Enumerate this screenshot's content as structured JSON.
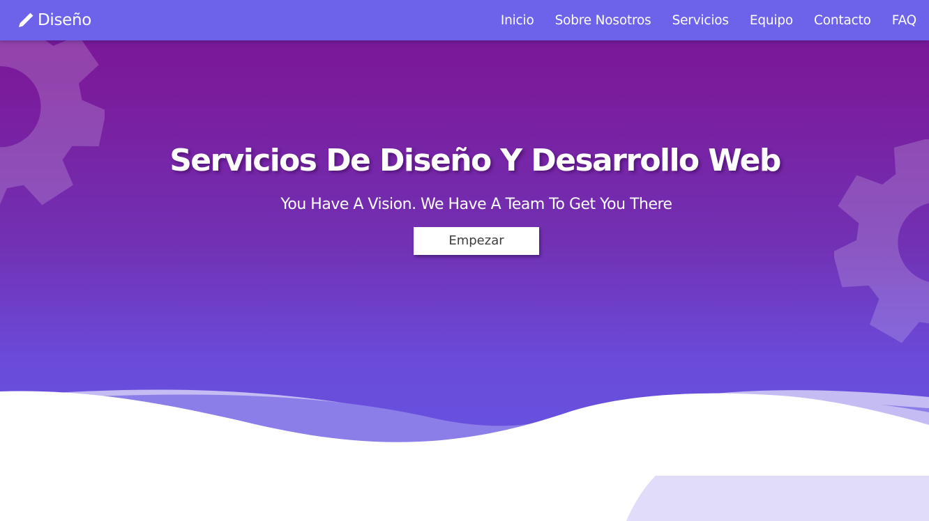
{
  "navbar": {
    "brand": {
      "icon": "pencil-icon",
      "name": "Diseño"
    },
    "links": [
      {
        "label": "Inicio"
      },
      {
        "label": "Sobre Nosotros"
      },
      {
        "label": "Servicios"
      },
      {
        "label": "Equipo"
      },
      {
        "label": "Contacto"
      },
      {
        "label": "FAQ"
      }
    ]
  },
  "hero": {
    "title": "Servicios De Diseño Y Desarrollo Web",
    "subtitle": "You Have A Vision. We Have A Team To Get You There",
    "cta_label": "Empezar",
    "decorations": [
      "gear-icon",
      "gear-icon"
    ]
  },
  "colors": {
    "navbar_bg": "#6c63ea",
    "hero_gradient_top": "#7b1697",
    "hero_gradient_bottom": "#6852e0",
    "wave_light": "#c4bcf3",
    "wave_mid": "#8b7ee8",
    "corner_shape": "#e1dcf9"
  }
}
